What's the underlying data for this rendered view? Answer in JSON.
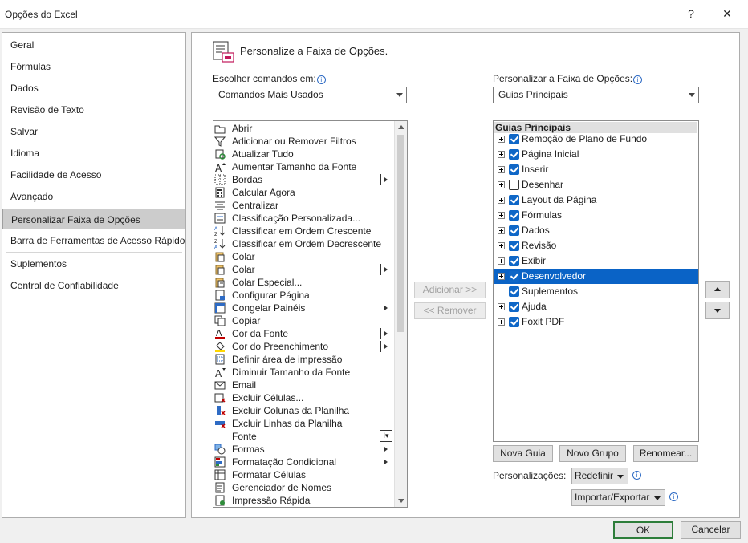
{
  "window": {
    "title": "Opções do Excel",
    "help": "?",
    "close": "✕"
  },
  "nav": {
    "items": [
      {
        "label": "Geral"
      },
      {
        "label": "Fórmulas"
      },
      {
        "label": "Dados"
      },
      {
        "label": "Revisão de Texto"
      },
      {
        "label": "Salvar"
      },
      {
        "label": "Idioma"
      },
      {
        "label": "Facilidade de Acesso"
      },
      {
        "label": "Avançado"
      },
      {
        "label": "Personalizar Faixa de Opções",
        "selected": true
      },
      {
        "label": "Barra de Ferramentas de Acesso Rápido"
      },
      {
        "label": "Suplementos"
      },
      {
        "label": "Central de Confiabilidade"
      }
    ]
  },
  "header": {
    "title": "Personalize a Faixa de Opções."
  },
  "left": {
    "label": "Escolher comandos em:",
    "combo_value": "Comandos Mais Usados",
    "commands": [
      {
        "label": "Abrir",
        "icon": "folder-open-icon"
      },
      {
        "label": "Adicionar ou Remover Filtros",
        "icon": "filter-icon"
      },
      {
        "label": "Atualizar Tudo",
        "icon": "refresh-all-icon"
      },
      {
        "label": "Aumentar Tamanho da Fonte",
        "icon": "grow-font-icon"
      },
      {
        "label": "Bordas",
        "icon": "borders-icon",
        "submenu": "split"
      },
      {
        "label": "Calcular Agora",
        "icon": "calculator-icon"
      },
      {
        "label": "Centralizar",
        "icon": "center-align-icon"
      },
      {
        "label": "Classificação Personalizada...",
        "icon": "custom-sort-icon"
      },
      {
        "label": "Classificar em Ordem Crescente",
        "icon": "sort-ascending-icon"
      },
      {
        "label": "Classificar em Ordem Decrescente",
        "icon": "sort-descending-icon"
      },
      {
        "label": "Colar",
        "icon": "paste-icon"
      },
      {
        "label": "Colar",
        "icon": "paste-icon",
        "submenu": "split"
      },
      {
        "label": "Colar Especial...",
        "icon": "paste-special-icon"
      },
      {
        "label": "Configurar Página",
        "icon": "page-setup-icon"
      },
      {
        "label": "Congelar Painéis",
        "icon": "freeze-panes-icon",
        "submenu": "arrow"
      },
      {
        "label": "Copiar",
        "icon": "copy-icon"
      },
      {
        "label": "Cor da Fonte",
        "icon": "font-color-icon",
        "submenu": "split"
      },
      {
        "label": "Cor do Preenchimento",
        "icon": "fill-color-icon",
        "submenu": "split"
      },
      {
        "label": "Definir área de impressão",
        "icon": "print-area-icon"
      },
      {
        "label": "Diminuir Tamanho da Fonte",
        "icon": "shrink-font-icon"
      },
      {
        "label": "Email",
        "icon": "email-icon"
      },
      {
        "label": "Excluir Células...",
        "icon": "delete-cells-icon"
      },
      {
        "label": "Excluir Colunas da Planilha",
        "icon": "delete-columns-icon"
      },
      {
        "label": "Excluir Linhas da Planilha",
        "icon": "delete-rows-icon"
      },
      {
        "label": "Fonte",
        "icon": "font-icon",
        "submenu": "box"
      },
      {
        "label": "Formas",
        "icon": "shapes-icon",
        "submenu": "arrow"
      },
      {
        "label": "Formatação Condicional",
        "icon": "conditional-format-icon",
        "submenu": "arrow"
      },
      {
        "label": "Formatar Células",
        "icon": "format-cells-icon"
      },
      {
        "label": "Gerenciador de Nomes",
        "icon": "name-manager-icon"
      },
      {
        "label": "Impressão Rápida",
        "icon": "quick-print-icon"
      }
    ]
  },
  "middle": {
    "add": "Adicionar >>",
    "remove": "<< Remover"
  },
  "right": {
    "label": "Personalizar a Faixa de Opções:",
    "combo_value": "Guias Principais",
    "tree_header": "Guias Principais",
    "tabs": [
      {
        "label": "Remoção de Plano de Fundo",
        "checked": true,
        "expander": true
      },
      {
        "label": "Página Inicial",
        "checked": true,
        "expander": true
      },
      {
        "label": "Inserir",
        "checked": true,
        "expander": true
      },
      {
        "label": "Desenhar",
        "checked": false,
        "expander": true
      },
      {
        "label": "Layout da Página",
        "checked": true,
        "expander": true
      },
      {
        "label": "Fórmulas",
        "checked": true,
        "expander": true
      },
      {
        "label": "Dados",
        "checked": true,
        "expander": true
      },
      {
        "label": "Revisão",
        "checked": true,
        "expander": true
      },
      {
        "label": "Exibir",
        "checked": true,
        "expander": true
      },
      {
        "label": "Desenvolvedor",
        "checked": true,
        "expander": true,
        "selected": true
      },
      {
        "label": "Suplementos",
        "checked": true,
        "expander": false
      },
      {
        "label": "Ajuda",
        "checked": true,
        "expander": true
      },
      {
        "label": "Foxit PDF",
        "checked": true,
        "expander": true
      }
    ],
    "new_tab": "Nova Guia",
    "new_group": "Novo Grupo",
    "rename": "Renomear...",
    "customizations_label": "Personalizações:",
    "reset": "Redefinir",
    "import_export": "Importar/Exportar"
  },
  "footer": {
    "ok": "OK",
    "cancel": "Cancelar"
  },
  "colors": {
    "selection": "#0a63c6",
    "checkbox": "#0f67c7",
    "ok_border": "#2d7d3a"
  }
}
